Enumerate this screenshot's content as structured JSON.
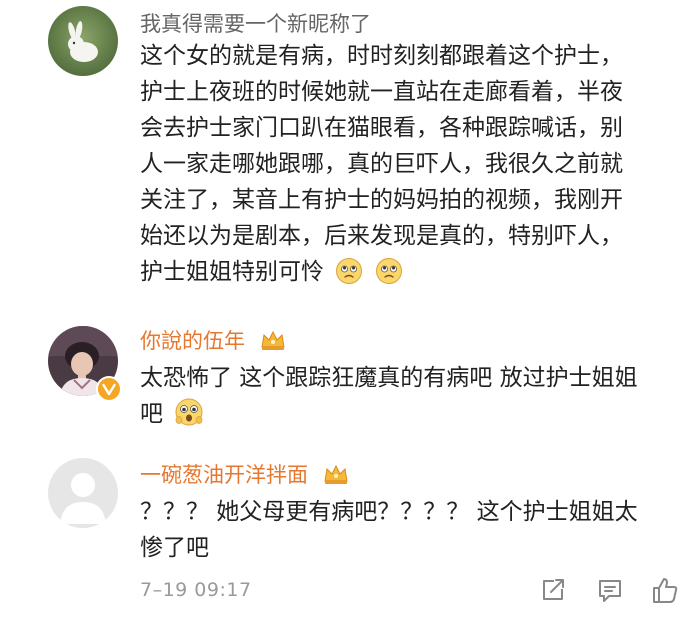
{
  "comments": [
    {
      "username": "我真得需要一个新昵称了",
      "text_lines": [
        "这个女的就是有病，时时刻刻都跟着这个护士，",
        "护士上夜班的时候她就一直站在走廊看着，半夜",
        "会去护士家门口趴在猫眼看，各种跟踪喊话，别",
        "人一家走哪她跟哪，真的巨吓人，我很久之前就",
        "关注了，某音上有护士的妈妈拍的视频，我刚开",
        "始还以为是剧本，后来发现是真的，特别吓人，",
        "护士姐姐特别可怜"
      ],
      "emojis": [
        "sad-emoji",
        "sad-emoji"
      ]
    },
    {
      "username": "你說的伍年",
      "text_lines": [
        "太恐怖了 这个跟踪狂魔真的有病吧 放过护士姐姐",
        "吧"
      ],
      "emojis": [
        "scared-emoji"
      ],
      "badges": [
        "crown-icon",
        "verified-v-icon"
      ]
    },
    {
      "username": "一碗葱油开洋拌面",
      "text_lines": [
        "？？？ 她父母更有病吧？？？？ 这个护士姐姐太",
        "惨了吧"
      ],
      "badges": [
        "crown-icon"
      ]
    }
  ],
  "footer": {
    "time": "7–19 09:17",
    "icons": [
      "share-icon",
      "comment-icon",
      "like-icon"
    ]
  },
  "colors": {
    "username_gray": "#666666",
    "username_orange": "#e8772e",
    "text": "#222222",
    "time": "#9a9a9a"
  }
}
